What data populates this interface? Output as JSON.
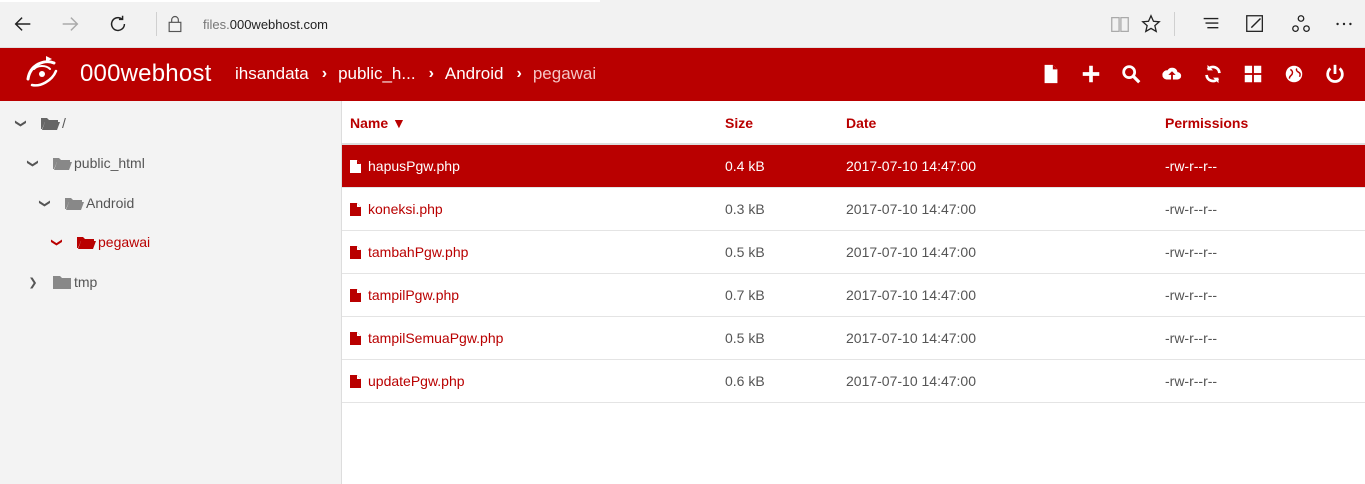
{
  "browser": {
    "url_prefix": "files.",
    "url_domain": "000webhost.com"
  },
  "app": {
    "brand": "000webhost",
    "breadcrumbs": [
      {
        "label": "ihsandata"
      },
      {
        "label": "public_h..."
      },
      {
        "label": "Android"
      },
      {
        "label": "pegawai"
      }
    ],
    "toolbar_icons": [
      "new-file-icon",
      "add-icon",
      "search-icon",
      "upload-icon",
      "refresh-icon",
      "grid-view-icon",
      "globe-icon",
      "power-icon"
    ]
  },
  "tree": [
    {
      "label": "/",
      "expanded": true,
      "active": false
    },
    {
      "label": "public_html",
      "expanded": true,
      "active": false
    },
    {
      "label": "Android",
      "expanded": true,
      "active": false
    },
    {
      "label": "pegawai",
      "expanded": true,
      "active": true
    },
    {
      "label": "tmp",
      "expanded": false,
      "active": false
    }
  ],
  "table": {
    "columns": {
      "name": "Name ▼",
      "size": "Size",
      "date": "Date",
      "permissions": "Permissions"
    },
    "rows": [
      {
        "name": "hapusPgw.php",
        "size": "0.4 kB",
        "date": "2017-07-10 14:47:00",
        "permissions": "-rw-r--r--",
        "selected": true
      },
      {
        "name": "koneksi.php",
        "size": "0.3 kB",
        "date": "2017-07-10 14:47:00",
        "permissions": "-rw-r--r--",
        "selected": false
      },
      {
        "name": "tambahPgw.php",
        "size": "0.5 kB",
        "date": "2017-07-10 14:47:00",
        "permissions": "-rw-r--r--",
        "selected": false
      },
      {
        "name": "tampilPgw.php",
        "size": "0.7 kB",
        "date": "2017-07-10 14:47:00",
        "permissions": "-rw-r--r--",
        "selected": false
      },
      {
        "name": "tampilSemuaPgw.php",
        "size": "0.5 kB",
        "date": "2017-07-10 14:47:00",
        "permissions": "-rw-r--r--",
        "selected": false
      },
      {
        "name": "updatePgw.php",
        "size": "0.6 kB",
        "date": "2017-07-10 14:47:00",
        "permissions": "-rw-r--r--",
        "selected": false
      }
    ]
  },
  "colors": {
    "brand": "#b90000",
    "sidebar_bg": "#f3f3f3"
  }
}
